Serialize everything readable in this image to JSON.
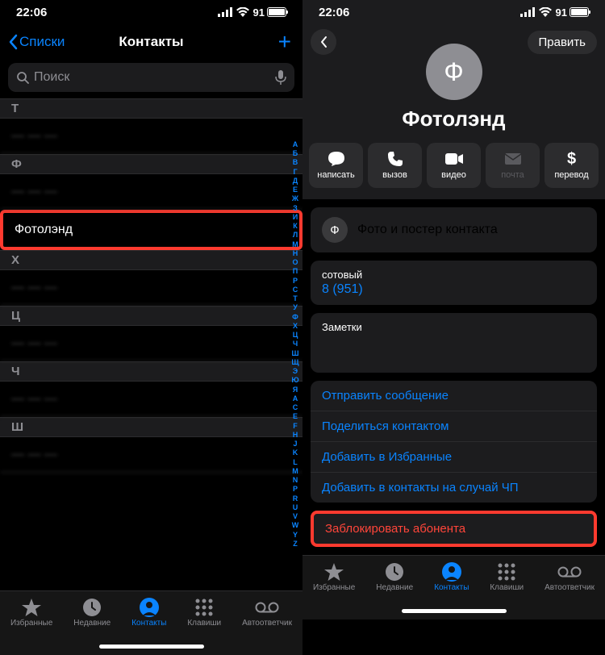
{
  "status": {
    "time": "22:06",
    "battery_pct": "91"
  },
  "left": {
    "back_label": "Списки",
    "title": "Контакты",
    "search_placeholder": "Поиск",
    "sections": [
      {
        "letter": "Т",
        "rows": [
          ""
        ]
      },
      {
        "letter": "Ф",
        "rows": [
          "",
          "Фотолэнд"
        ]
      },
      {
        "letter": "Х",
        "rows": [
          ""
        ]
      },
      {
        "letter": "Ц",
        "rows": [
          ""
        ]
      },
      {
        "letter": "Ч",
        "rows": [
          ""
        ]
      },
      {
        "letter": "Ш",
        "rows": [
          ""
        ]
      }
    ],
    "highlighted_row": "Фотолэнд",
    "alpha_index": [
      "А",
      "Б",
      "В",
      "Г",
      "Д",
      "Е",
      "Ж",
      "З",
      "И",
      "К",
      "Л",
      "М",
      "Н",
      "О",
      "П",
      "Р",
      "С",
      "Т",
      "У",
      "Ф",
      "Х",
      "Ц",
      "Ч",
      "Ш",
      "Щ",
      "Э",
      "Ю",
      "Я",
      "A",
      "C",
      "E",
      "F",
      "H",
      "J",
      "K",
      "L",
      "M",
      "N",
      "P",
      "R",
      "U",
      "V",
      "W",
      "Y",
      "Z"
    ]
  },
  "right": {
    "edit_label": "Править",
    "avatar_letter": "Ф",
    "contact_name": "Фотолэнд",
    "actions": {
      "message": "написать",
      "call": "вызов",
      "video": "видео",
      "mail": "почта",
      "pay": "перевод"
    },
    "photo_card_label": "Фото и постер контакта",
    "phone_label": "сотовый",
    "phone_number": "8 (951) ",
    "notes_label": "Заметки",
    "links": {
      "send_message": "Отправить сообщение",
      "share_contact": "Поделиться контактом",
      "add_favorites": "Добавить в Избранные",
      "add_emergency": "Добавить в контакты на случай ЧП"
    },
    "block_label": "Заблокировать абонента"
  },
  "tabs": {
    "favorites": "Избранные",
    "recents": "Недавние",
    "contacts": "Контакты",
    "keypad": "Клавиши",
    "voicemail": "Автоответчик"
  }
}
